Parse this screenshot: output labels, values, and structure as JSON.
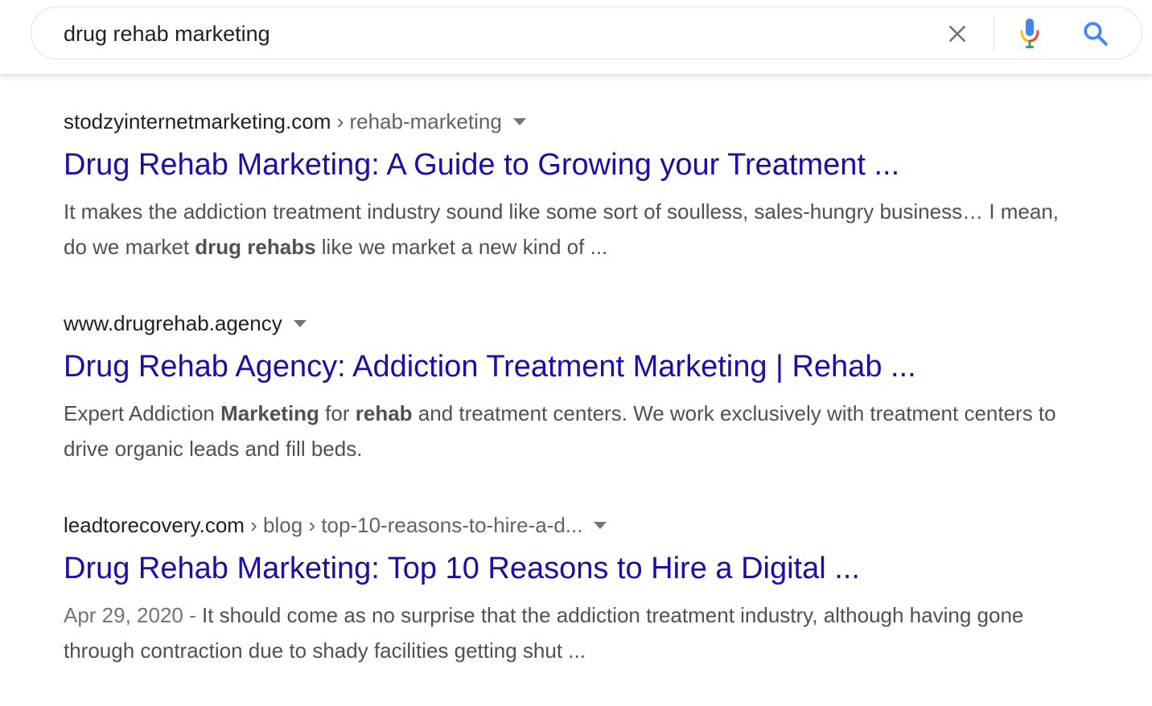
{
  "search": {
    "query": "drug rehab marketing",
    "clear_icon": "close-icon",
    "mic_icon": "microphone-icon",
    "search_icon": "search-icon",
    "colors": {
      "mic_blue": "#4285f4",
      "mic_red": "#ea4335",
      "mic_yellow": "#fbbc05",
      "mic_green": "#34a853",
      "search_blue": "#4285f4"
    }
  },
  "results": [
    {
      "domain": "stodzyinternetmarketing.com",
      "path": " › rehab-marketing",
      "title": "Drug Rehab Marketing: A Guide to Growing your Treatment ...",
      "snippet": {
        "p1": "It makes the addiction treatment industry sound like some sort of soulless, sales-hungry business… I mean, do we market ",
        "b1": "drug rehabs",
        "p2": " like we market a new kind of ..."
      }
    },
    {
      "domain": "www.drugrehab.agency",
      "path": "",
      "title": "Drug Rehab Agency: Addiction Treatment Marketing | Rehab ...",
      "snippet": {
        "p1": "Expert Addiction ",
        "b1": "Marketing",
        "p2": " for ",
        "b2": "rehab",
        "p3": " and treatment centers. We work exclusively with treatment centers to drive organic leads and fill beds."
      }
    },
    {
      "domain": "leadtorecovery.com",
      "path": " › blog › top-10-reasons-to-hire-a-d...",
      "title": "Drug Rehab Marketing: Top 10 Reasons to Hire a Digital ...",
      "snippet": {
        "date": "Apr 29, 2020 - ",
        "p1": "It should come as no surprise that the addiction treatment industry, although having gone through contraction due to shady facilities getting shut ..."
      }
    }
  ],
  "colors": {
    "title_link": "#1a0dab",
    "snippet_text": "#4d5156",
    "url_text": "#202124",
    "url_path": "#5f6368"
  }
}
